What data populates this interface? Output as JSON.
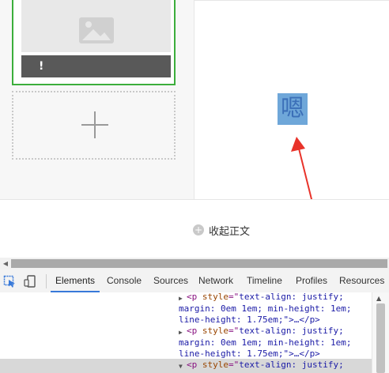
{
  "editor": {
    "thumbnail_badge": "!",
    "selected_character": "嗯",
    "collapse_label": "收起正文"
  },
  "devtools": {
    "tabs": [
      "Elements",
      "Console",
      "Sources",
      "Network",
      "Timeline",
      "Profiles",
      "Resources"
    ],
    "active_tab": "Elements",
    "code_lines": [
      {
        "prefix": "<p ",
        "attr": "style",
        "eq": "=\"",
        "val": "text-align: justify;",
        "rest": ""
      },
      {
        "text": "margin: 0em 1em; min-height: 1em;"
      },
      {
        "text": "line-height: 1.75em;\">…</p>"
      },
      {
        "prefix": "<p ",
        "attr": "style",
        "eq": "=\"",
        "val": "text-align: justify;",
        "rest": ""
      },
      {
        "text": "margin: 0em 1em; min-height: 1em;"
      },
      {
        "text": "line-height: 1.75em;\">…</p>"
      },
      {
        "prefix": "<p ",
        "attr": "style",
        "eq": "=\"",
        "val": "text-align: justify;",
        "rest": ""
      }
    ]
  },
  "colors": {
    "selection_green": "#3cae3c",
    "text_selection": "#6fa7d9",
    "annotation_arrow": "#e8332a",
    "devtools_accent": "#3879d9"
  }
}
